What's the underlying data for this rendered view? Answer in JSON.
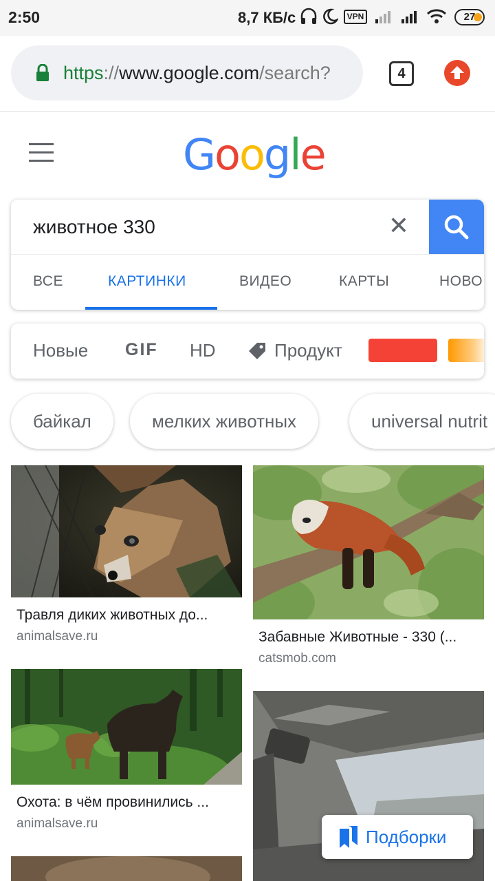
{
  "status_bar": {
    "time": "2:50",
    "network_speed": "8,7 КБ/с",
    "vpn": "VPN",
    "battery": "27"
  },
  "browser": {
    "url_protocol": "https",
    "url_separator": "://",
    "url_host": "www.google.com",
    "url_path": "/search?",
    "tab_count": "4",
    "icons": [
      "lock-icon",
      "upload-icon"
    ]
  },
  "google": {
    "logo": [
      "G",
      "o",
      "o",
      "g",
      "l",
      "e"
    ],
    "query": "животное 330",
    "clear_symbol": "✕"
  },
  "tabs": [
    {
      "label": "ВСЕ",
      "active": false
    },
    {
      "label": "КАРТИНКИ",
      "active": true
    },
    {
      "label": "ВИДЕО",
      "active": false
    },
    {
      "label": "КАРТЫ",
      "active": false
    },
    {
      "label": "НОВО",
      "active": false
    }
  ],
  "filters": {
    "new": "Новые",
    "gif": "GIF",
    "hd": "HD",
    "product": "Продукт",
    "colors": [
      "#f44336",
      "#ff9800"
    ]
  },
  "chips": [
    "байкал",
    "мелких животных",
    "universal nutrit"
  ],
  "results": [
    {
      "title": "Травля диких животных до...",
      "source": "animalsave.ru",
      "image": "fox"
    },
    {
      "title": "Забавные Животные - 330 (...",
      "source": "catsmob.com",
      "image": "red-panda"
    },
    {
      "title": "Охота: в чём провинились ...",
      "source": "animalsave.ru",
      "image": "moose"
    },
    {
      "title": "",
      "source": "",
      "image": "car-interior"
    }
  ],
  "collections_button": "Подборки"
}
